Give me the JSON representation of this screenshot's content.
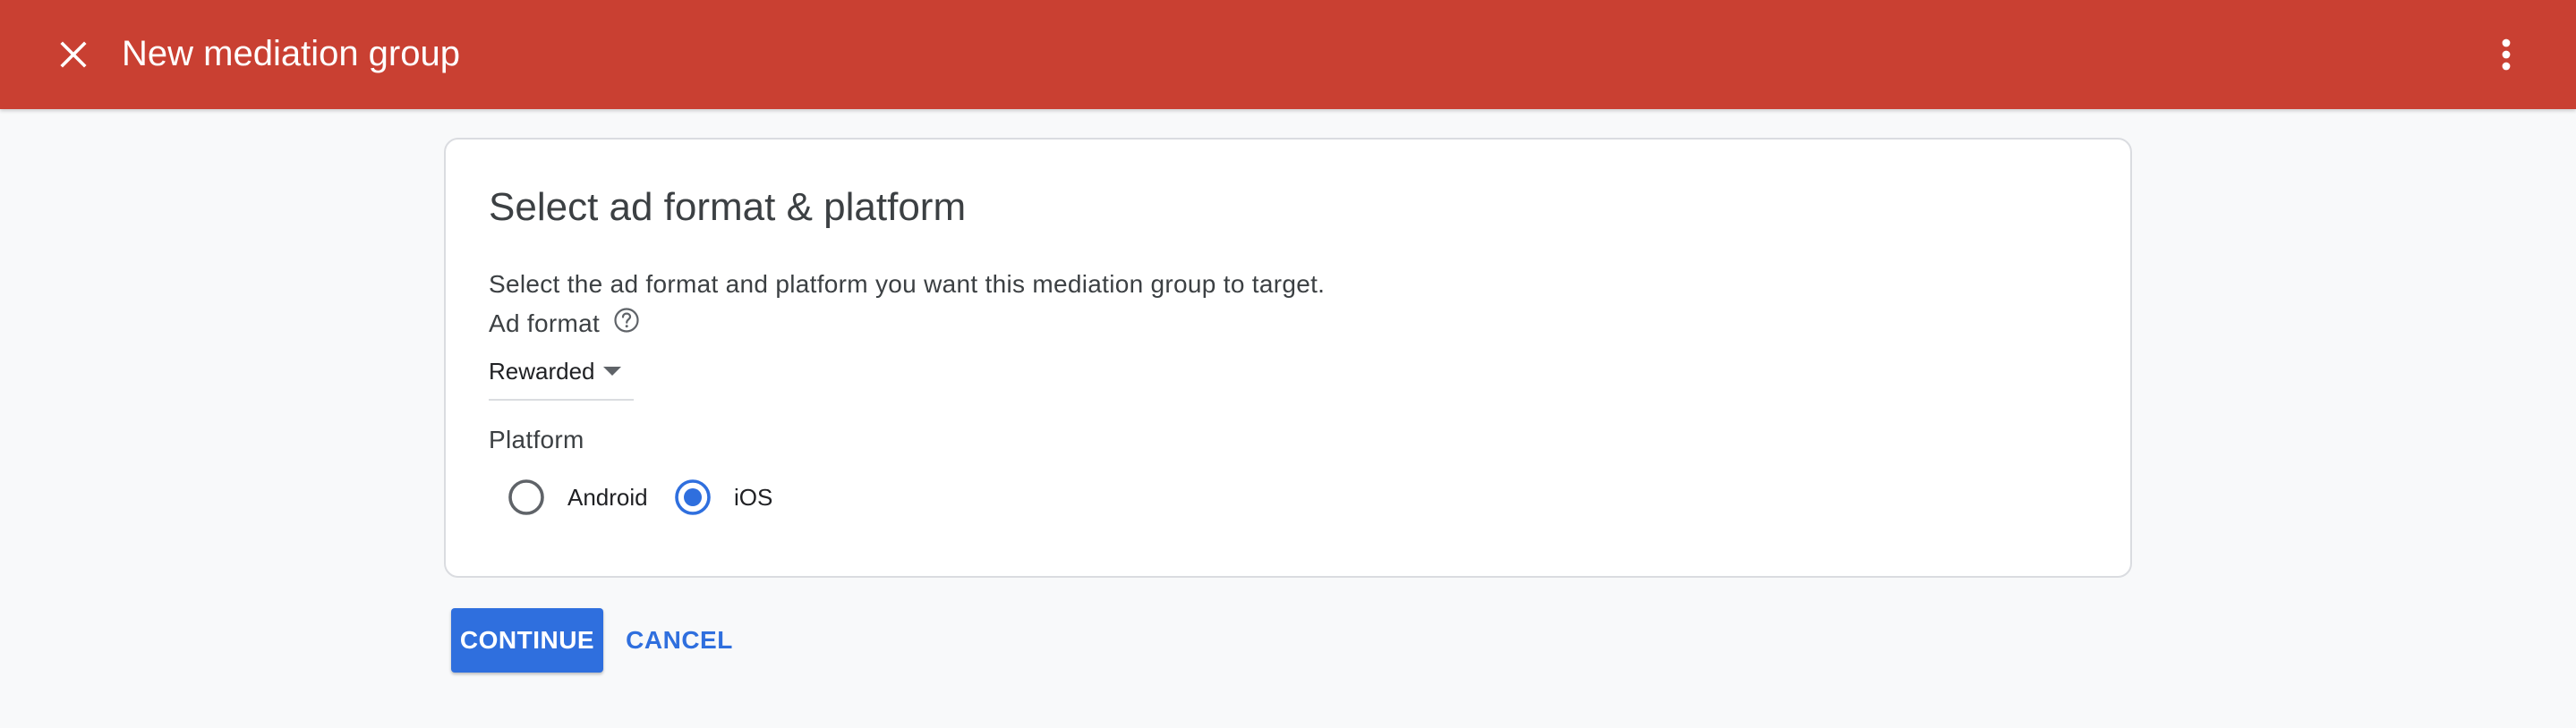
{
  "header": {
    "title": "New mediation group",
    "close_icon": "close-icon",
    "menu_icon": "more-vert-icon",
    "bar_color": "#c94032"
  },
  "card": {
    "title": "Select ad format & platform",
    "description": "Select the ad format and platform you want this mediation group to target.",
    "ad_format": {
      "label": "Ad format",
      "help_icon": "help-circle-icon",
      "selected_value": "Rewarded",
      "dropdown_icon": "arrow-drop-down-icon"
    },
    "platform": {
      "label": "Platform",
      "options": [
        {
          "label": "Android",
          "selected": false
        },
        {
          "label": "iOS",
          "selected": true
        }
      ]
    }
  },
  "actions": {
    "continue_label": "CONTINUE",
    "cancel_label": "CANCEL",
    "accent_color": "#2f6fde"
  }
}
